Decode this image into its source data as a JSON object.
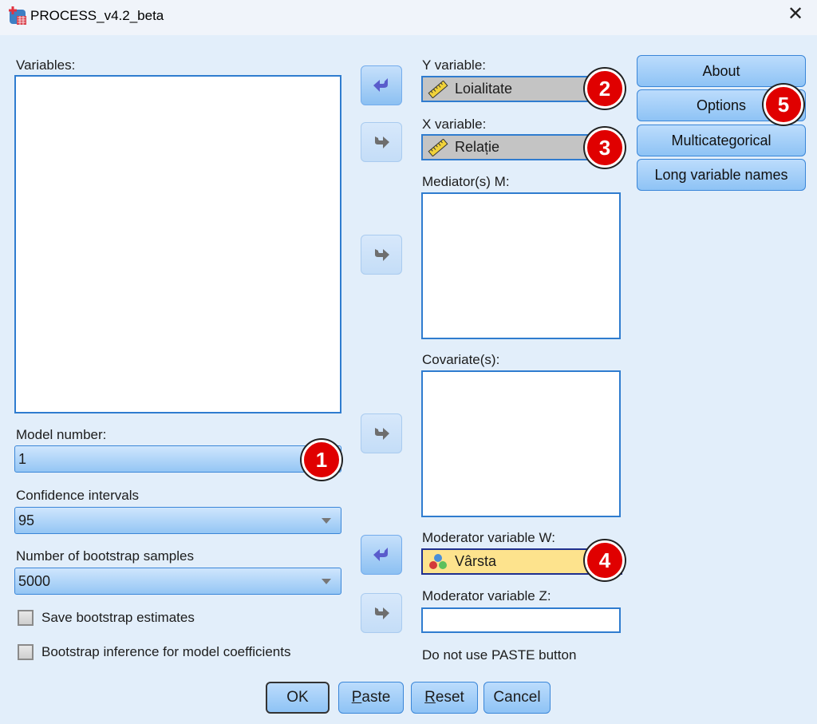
{
  "window": {
    "title": "PROCESS_v4.2_beta",
    "close_icon": "close-x"
  },
  "variables": {
    "label": "Variables:",
    "items": []
  },
  "model_number": {
    "label": "Model number:",
    "value": "1"
  },
  "confidence_intervals": {
    "label": "Confidence intervals",
    "value": "95"
  },
  "bootstrap_samples": {
    "label": "Number of bootstrap samples",
    "value": "5000"
  },
  "checkboxes": [
    {
      "label": "Save bootstrap estimates",
      "checked": false
    },
    {
      "label": "Bootstrap inference for model coefficients",
      "checked": false
    }
  ],
  "y_variable": {
    "label": "Y variable:",
    "value": "Loialitate",
    "icon": "scale-ruler-icon"
  },
  "x_variable": {
    "label": "X variable:",
    "value": "Relație",
    "icon": "scale-ruler-icon"
  },
  "mediators": {
    "label": "Mediator(s) M:",
    "items": []
  },
  "covariates": {
    "label": "Covariate(s):",
    "items": []
  },
  "moderator_w": {
    "label": "Moderator variable W:",
    "value": "Vârsta",
    "icon": "nominal-icon"
  },
  "moderator_z": {
    "label": "Moderator variable Z:",
    "value": ""
  },
  "note": "Do not use PASTE button",
  "side_buttons": {
    "about": "About",
    "options": "Options",
    "multicategorical": "Multicategorical",
    "long_names": "Long variable names"
  },
  "bottom_buttons": {
    "ok": "OK",
    "paste_key": "P",
    "paste_rest": "aste",
    "reset_key": "R",
    "reset_rest": "eset",
    "cancel": "Cancel"
  },
  "badges": {
    "b1": "1",
    "b2": "2",
    "b3": "3",
    "b4": "4",
    "b5": "5"
  }
}
